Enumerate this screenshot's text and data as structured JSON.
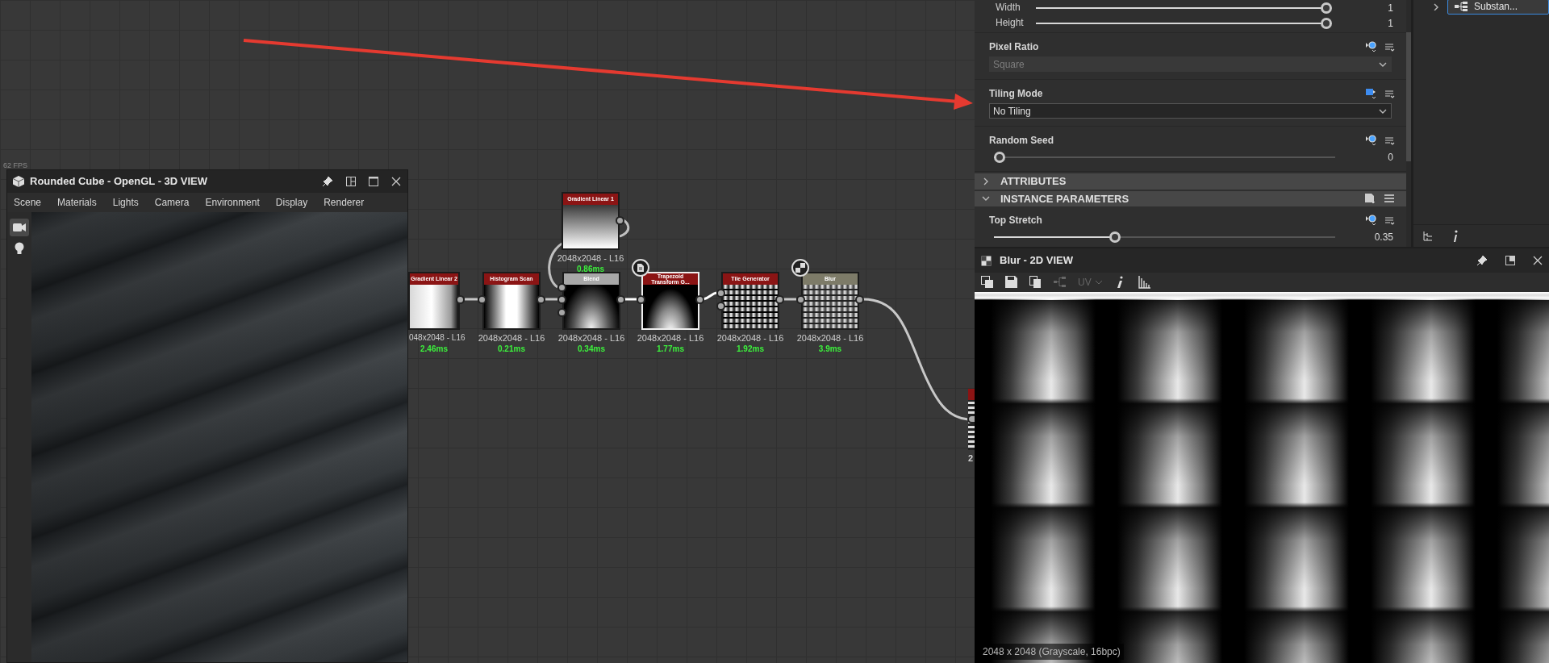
{
  "graph": {
    "nodes": [
      {
        "title": "Gradient Linear 2",
        "resolution": "048x2048 - L16",
        "time": "2.46ms",
        "color": "#8b1414",
        "kind": "ramp",
        "selected": false,
        "badge": false
      },
      {
        "title": "Histogram Scan",
        "resolution": "2048x2048 - L16",
        "time": "0.21ms",
        "color": "#8b1414",
        "kind": "band",
        "selected": false,
        "badge": false
      },
      {
        "title": "Gradient Linear 1",
        "resolution": "2048x2048 - L16",
        "time": "0.86ms",
        "color": "#8b1414",
        "kind": "vertical",
        "selected": false,
        "badge": false
      },
      {
        "title": "Blend",
        "resolution": "2048x2048 - L16",
        "time": "0.34ms",
        "color": "#a8a8a8",
        "kind": "glow",
        "selected": false,
        "badge": false
      },
      {
        "title": "Trapezoid Transform G...",
        "resolution": "2048x2048 - L16",
        "time": "1.77ms",
        "color": "#8b1414",
        "kind": "trapezoid",
        "selected": true,
        "badge": true
      },
      {
        "title": "Tile Generator",
        "resolution": "2048x2048 - L16",
        "time": "1.92ms",
        "color": "#8b1414",
        "kind": "tiles",
        "selected": false,
        "badge": false
      },
      {
        "title": "Blur",
        "resolution": "2048x2048 - L16",
        "time": "3.9ms",
        "color": "#7d7b68",
        "kind": "blurred-tiles",
        "selected": false,
        "badge": true
      }
    ],
    "edge_node": {
      "resolution": "2"
    }
  },
  "view_3d": {
    "title": "Rounded Cube - OpenGL - 3D VIEW",
    "fps": "62 FPS",
    "menu": [
      "Scene",
      "Materials",
      "Lights",
      "Camera",
      "Environment",
      "Display",
      "Renderer"
    ],
    "tools": [
      {
        "kind": "camera",
        "selected": true
      },
      {
        "kind": "light",
        "selected": false
      }
    ]
  },
  "parameters": {
    "rows": [
      {
        "kind": "inline-slider",
        "label": "Width",
        "level": 1,
        "value": "1"
      },
      {
        "kind": "inline-slider",
        "label": "Height",
        "level": 1,
        "value": "1"
      },
      {
        "kind": "dropdown",
        "label": "Pixel Ratio",
        "value": "Square",
        "disabled": true
      },
      {
        "kind": "dropdown",
        "label": "Tiling Mode",
        "value": "No Tiling",
        "disabled": false
      },
      {
        "kind": "slider",
        "label": "Random Seed",
        "level": 0,
        "value": "0"
      }
    ],
    "sections": [
      {
        "title": "ATTRIBUTES",
        "expanded": false
      },
      {
        "title": "INSTANCE PARAMETERS",
        "expanded": true,
        "rows": [
          {
            "kind": "slider",
            "label": "Top Stretch",
            "level": 0.35,
            "value": "0.35"
          }
        ]
      }
    ]
  },
  "explorer": {
    "items": [
      {
        "label": "Substan...",
        "selected": true
      }
    ]
  },
  "view_2d": {
    "title": "Blur - 2D VIEW",
    "toolbar": [
      {
        "kind": "layers",
        "disabled": false
      },
      {
        "kind": "save",
        "disabled": false
      },
      {
        "kind": "copy",
        "disabled": false
      },
      {
        "kind": "share",
        "disabled": true
      },
      {
        "kind": "uv",
        "label": "UV",
        "disabled": true
      },
      {
        "kind": "info",
        "disabled": false
      },
      {
        "kind": "histogram",
        "disabled": false
      }
    ],
    "caption": "2048 x 2048 (Grayscale, 16bpc)"
  }
}
